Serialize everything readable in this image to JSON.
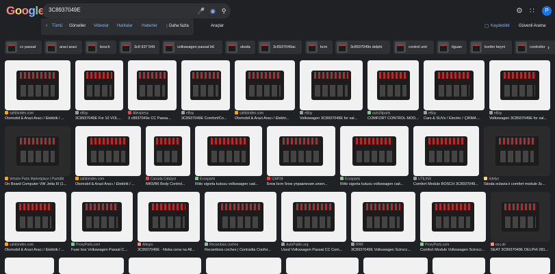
{
  "logo": "Google",
  "search": {
    "query": "3C8937049E"
  },
  "nav": {
    "items": [
      "Tümü",
      "Görseller",
      "Videolar",
      "Haritalar",
      "Haberler",
      "Daha fazla"
    ],
    "tools": "Araçlar",
    "saved": "Kaydedildi",
    "safesearch": "Güvenli Arama"
  },
  "chips": [
    "cc passat",
    "araci araci",
    "bosch",
    "3c8 937 049",
    "volkswagen passat b6",
    "skoda",
    "3c8937049ac",
    "bcm",
    "3c8937049e delphi",
    "control unit",
    "tiguan",
    "konfor beyni",
    "controller"
  ],
  "rows": [
    [
      {
        "src": "sahibinden.com",
        "title": "Otomobil & Arazi Aracı / Elektrik / ..."
      },
      {
        "src": "eBay",
        "title": "3C8937049E For 10 VOL..."
      },
      {
        "src": "Aliexpress",
        "title": "3 c8937049e CC Passa..."
      },
      {
        "src": "eBay",
        "title": "3C8937049E Comfort/Co..."
      },
      {
        "src": "sahibinden.com",
        "title": "Otomobil & Arazi Aracı / Elektri..."
      },
      {
        "src": "eBay",
        "title": "Volkswagen 3C8937049E for sal..."
      },
      {
        "src": "auto24parts",
        "title": "COMFORT CONTROL MOD..."
      },
      {
        "src": "eBay",
        "title": "Cars & SUVs / Electric / ÇIKMA ..."
      },
      {
        "src": "eBay",
        "title": "Volkswagen 3C8937049E for sal..."
      }
    ],
    [
      {
        "src": "Vehicle Parts Marketplace | PartsBit",
        "title": "On Board Computer VW Jetta III (1..."
      },
      {
        "src": "sahibinden.com",
        "title": "Otomobil & Arazi Aracı / Elektrik / ..."
      },
      {
        "src": "Canada Catalyst",
        "title": "MK5/B6 Body Control..."
      },
      {
        "src": "Ecosparts",
        "title": "Röle sigorta kutusu volkswagen cad..."
      },
      {
        "src": "IZAP24",
        "title": "Блок bcm блок управления элект..."
      },
      {
        "src": "Ecosparts",
        "title": "Röle sigorta kutusu volkswagen cad..."
      },
      {
        "src": "UTILINX",
        "title": "Comfort Module BOSCH 3C8937049..."
      },
      {
        "src": "Xdelys",
        "title": "Skoda octavia ii comfort module 3c..."
      }
    ],
    [
      {
        "src": "sahibinden.com",
        "title": "Otomobil & Arazi Aracı / Elektrik / ..."
      },
      {
        "src": "ProxyParts.com",
        "title": "Fuse box Volkswagen Passat C..."
      },
      {
        "src": "Allegro",
        "title": "3C8937049E - Niska cena na All..."
      },
      {
        "src": "Recambios coches",
        "title": "Recambios coches | Centralita Confor..."
      },
      {
        "src": "AutoPublic.org",
        "title": "Used Volkswagen Passat CC Com..."
      },
      {
        "src": "RRR",
        "title": "3C8937049E Volkswagen Scirocc..."
      },
      {
        "src": "ProxyParts.com",
        "title": "Comfort Module Volkswagen Scirocc..."
      },
      {
        "src": "ecu.de",
        "title": "SEAT 3C8937049E DELPHI 281..."
      }
    ]
  ],
  "colors": {
    "background": "#202124",
    "accent": "#8ab4f8",
    "text": "#e8eaed"
  }
}
